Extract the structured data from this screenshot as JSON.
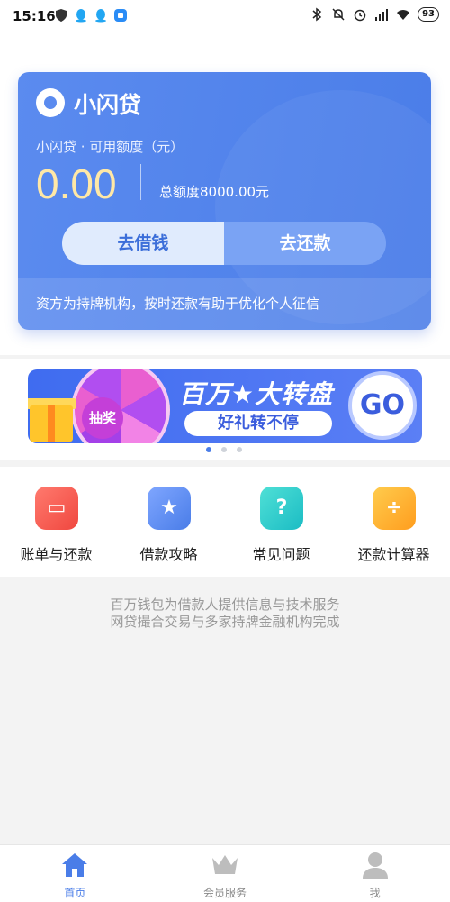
{
  "status_bar": {
    "time": "15:16",
    "battery": "93"
  },
  "card": {
    "brand": "小闪贷",
    "available_label": "小闪贷 · 可用额度（元）",
    "available_amount": "0.00",
    "total_label": "总额度8000.00元",
    "borrow_button": "去借钱",
    "repay_button": "去还款",
    "footer_note": "资方为持牌机构，按时还款有助于优化个人征信"
  },
  "banner": {
    "wheel_text": "抽奖",
    "title": "百万★大转盘",
    "subtitle": "好礼转不停",
    "go": "GO",
    "active_index": 0,
    "count": 3
  },
  "menu": [
    {
      "label": "账单与还款",
      "icon": "bill-icon",
      "glyph": "▭"
    },
    {
      "label": "借款攻略",
      "icon": "guide-icon",
      "glyph": "★"
    },
    {
      "label": "常见问题",
      "icon": "faq-icon",
      "glyph": "?"
    },
    {
      "label": "还款计算器",
      "icon": "calculator-icon",
      "glyph": "÷"
    }
  ],
  "disclaimer": {
    "line1": "百万钱包为借款人提供信息与技术服务",
    "line2": "网贷撮合交易与多家持牌金融机构完成"
  },
  "bottom_nav": [
    {
      "label": "首页",
      "icon": "home-icon",
      "active": true
    },
    {
      "label": "会员服务",
      "icon": "crown-icon",
      "active": false
    },
    {
      "label": "我",
      "icon": "user-icon",
      "active": false
    }
  ],
  "colors": {
    "accent": "#4a7de8",
    "amount": "#ffe8a6"
  }
}
